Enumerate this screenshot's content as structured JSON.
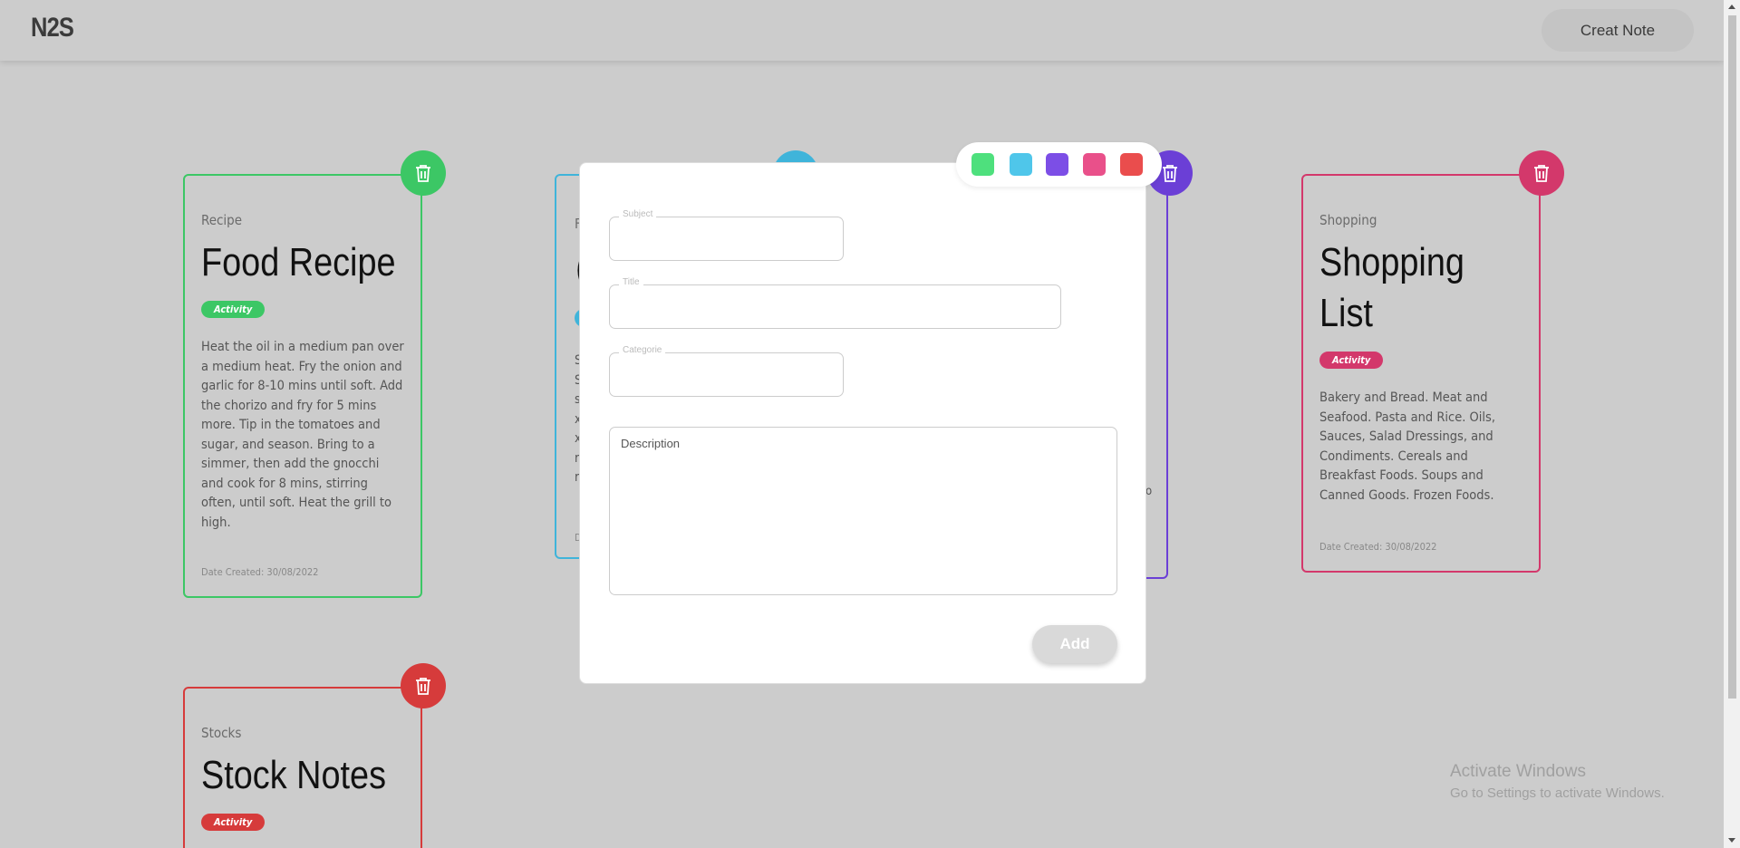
{
  "app": {
    "logo": "N2S",
    "create_button": "Creat Note"
  },
  "cards": {
    "food": {
      "category": "Recipe",
      "title": "Food Recipe",
      "badge": "Activity",
      "description": "Heat the oil in a medium pan over a medium heat. Fry the onion and garlic for 8-10 mins until soft. Add the chorizo and fry for 5 mins more. Tip in the tomatoes and sugar, and season. Bring to a simmer, then add the gnocchi and cook for 8 mins, stirring often, until soft. Heat the grill to high.",
      "date": "Date Created: 30/08/2022",
      "color": "#3cc765"
    },
    "hidden_blue": {
      "category_initial": "F",
      "title_initial": "(",
      "desc_initials": [
        "S",
        "S",
        "s",
        "x",
        "x",
        "r",
        "r"
      ],
      "date_initial": "D",
      "color": "#3fb4da"
    },
    "hidden_purple": {
      "color": "#6b3fd6",
      "desc_fragment": "o"
    },
    "shopping": {
      "category": "Shopping",
      "title": "Shopping List",
      "badge": "Activity",
      "description": "Bakery and Bread. Meat and Seafood. Pasta and Rice. Oils, Sauces, Salad Dressings, and Condiments. Cereals and Breakfast Foods. Soups and Canned Goods. Frozen Foods.",
      "date": "Date Created: 30/08/2022",
      "color": "#d3386b"
    },
    "stock": {
      "category": "Stocks",
      "title": "Stock Notes",
      "badge": "Activity",
      "color": "#d63b3b"
    }
  },
  "modal": {
    "subject_label": "Subject",
    "title_label": "Title",
    "category_label": "Categorie",
    "description_placeholder": "Description",
    "add_button": "Add"
  },
  "palette": {
    "colors": [
      "#4ee07d",
      "#4fc6ea",
      "#7c4ee6",
      "#e9508a",
      "#ea4d4d"
    ]
  },
  "watermark": {
    "line1": "Activate Windows",
    "line2": "Go to Settings to activate Windows."
  }
}
